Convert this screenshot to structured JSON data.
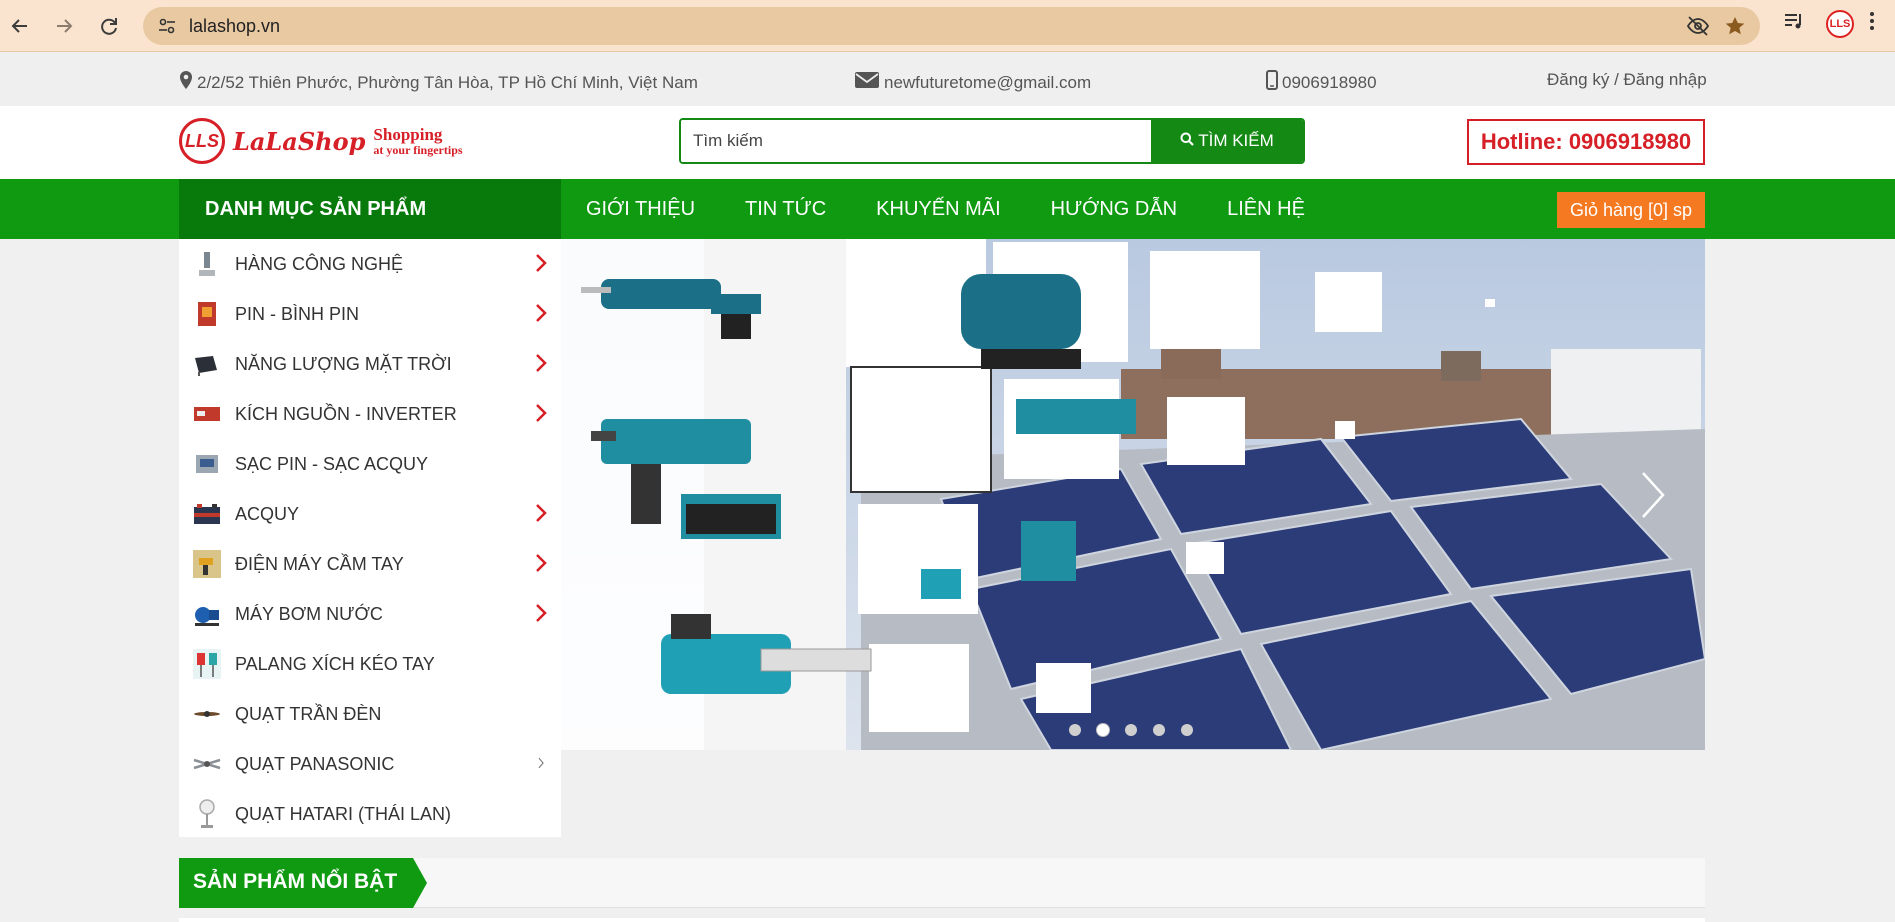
{
  "browser": {
    "url": "lalashop.vn",
    "icons": [
      "back-icon",
      "forward-icon",
      "reload-icon",
      "site-info-icon",
      "eye-off-icon",
      "star-icon",
      "media-icon",
      "profile-avatar",
      "menu-icon"
    ]
  },
  "topbar": {
    "address": "2/2/52 Thiên Phước, Phường Tân Hòa, TP Hồ Chí Minh, Việt Nam",
    "email": "newfuturetome@gmail.com",
    "phone": "0906918980",
    "auth": "Đăng ký / Đăng nhập"
  },
  "header": {
    "logo_mark": "LLS",
    "logo_name": "LaLaShop",
    "logo_tagline_1": "Shopping",
    "logo_tagline_2": "at your fingertips",
    "search_placeholder": "Tìm kiếm",
    "search_button": "TÌM KIẾM",
    "hotline": "Hotline: 0906918980"
  },
  "nav": {
    "category_title": "DANH MỤC SẢN PHẨM",
    "menu": [
      "GIỚI THIỆU",
      "TIN TỨC",
      "KHUYẾN MÃI",
      "HƯỚNG DẪN",
      "LIÊN HỆ"
    ],
    "cart": "Giỏ hàng [0] sp"
  },
  "sidebar": {
    "items": [
      {
        "label": "HÀNG CÔNG NGHỆ",
        "has_arrow": true
      },
      {
        "label": "PIN - BÌNH PIN",
        "has_arrow": true
      },
      {
        "label": "NĂNG LƯỢNG MẶT TRỜI",
        "has_arrow": true
      },
      {
        "label": "KÍCH NGUỒN - INVERTER",
        "has_arrow": true
      },
      {
        "label": "SẠC PIN - SẠC ACQUY",
        "has_arrow": false
      },
      {
        "label": "ACQUY",
        "has_arrow": true
      },
      {
        "label": "ĐIỆN MÁY CẦM TAY",
        "has_arrow": true
      },
      {
        "label": "MÁY BƠM NƯỚC",
        "has_arrow": true
      },
      {
        "label": "PALANG XÍCH KÉO TAY",
        "has_arrow": false
      },
      {
        "label": "QUẠT TRẦN ĐÈN",
        "has_arrow": false
      },
      {
        "label": "QUẠT PANASONIC",
        "has_arrow": true
      },
      {
        "label": "QUẠT HATARI (THÁI LAN)",
        "has_arrow": false
      }
    ]
  },
  "banner": {
    "slide_count": 5,
    "active_slide": 2
  },
  "featured": {
    "title": "SẢN PHẨM NỔI BẬT"
  },
  "colors": {
    "green": "#0f9a12",
    "dark_green": "#087a0c",
    "red": "#d61f26",
    "orange": "#f47920"
  }
}
